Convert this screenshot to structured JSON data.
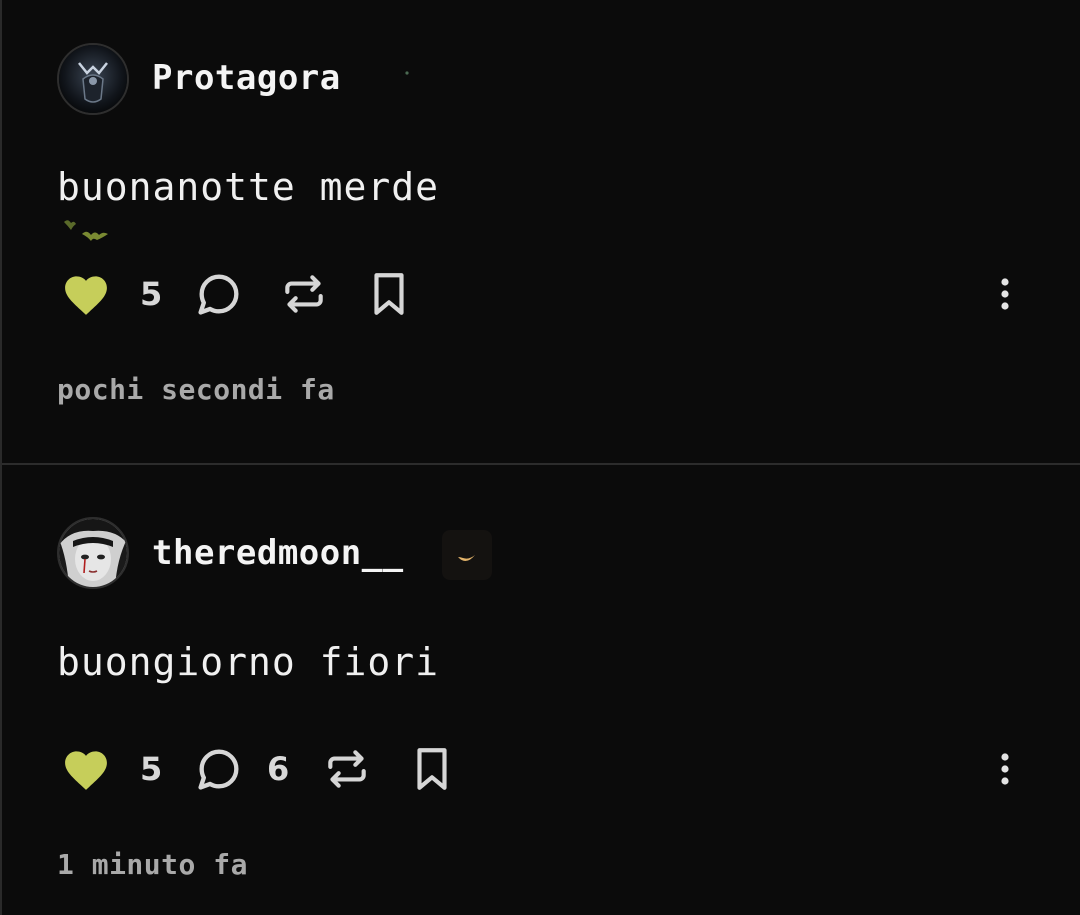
{
  "theme": {
    "background": "#0b0b0b",
    "accent_like": "#c6ce5a",
    "icon_color": "#d6d6d6"
  },
  "posts": [
    {
      "username": "Protagora",
      "avatar_icon": "dark-figure-avatar",
      "badge_icon": "tiny-dot-badge",
      "text": "buonanotte merde",
      "sticker_icon": "bats-sticker",
      "likes": "5",
      "liked": true,
      "comments": "",
      "timestamp": "pochi secondi fa"
    },
    {
      "username": "theredmoon__",
      "avatar_icon": "girl-portrait-avatar",
      "badge_icon": "crescent-moon-badge",
      "text": "buongiorno fiori",
      "likes": "5",
      "liked": true,
      "comments": "6",
      "timestamp": "1 minuto fa"
    }
  ]
}
